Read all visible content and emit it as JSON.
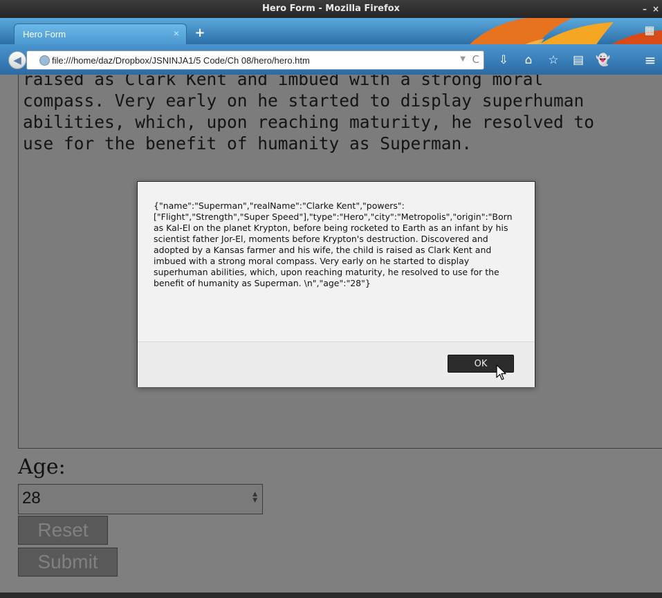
{
  "window": {
    "title": "Hero Form - Mozilla Firefox",
    "controls": [
      "–",
      "×"
    ]
  },
  "tabs": [
    {
      "label": "Hero Form",
      "close": "×"
    }
  ],
  "newtab": "+",
  "nav": {
    "back": "◀",
    "url": "file:///home/daz/Dropbox/JSNINJA1/5 Code/Ch 08/hero/hero.htm",
    "url_dropdown": "▼",
    "reload": "C",
    "icons": [
      "download-icon",
      "home-icon",
      "bookmark-star-icon",
      "reading-list-icon",
      "ghostery-icon"
    ],
    "icon_glyphs": [
      "⇩",
      "⌂",
      "☆",
      "▤",
      "👻"
    ],
    "menu": "≡",
    "tab_groups": "▦"
  },
  "page": {
    "origin_text": "raised as Clark Kent and imbued with a strong moral\ncompass. Very early on he started to display superhuman\nabilities, which, upon reaching maturity, he resolved to\nuse for the benefit of humanity as Superman.",
    "age_label": "Age:",
    "age_value": "28",
    "reset_label": "Reset",
    "submit_label": "Submit"
  },
  "dialog": {
    "message": "{\"name\":\"Superman\",\"realName\":\"Clarke Kent\",\"powers\":[\"Flight\",\"Strength\",\"Super Speed\"],\"type\":\"Hero\",\"city\":\"Metropolis\",\"origin\":\"Born as Kal-El on the planet Krypton, before being rocketed to Earth as an infant by his scientist father Jor-El, moments before Krypton's destruction. Discovered and adopted by a Kansas farmer and his wife, the child is raised as Clark Kent and imbued with a strong moral compass. Very early on he started to display superhuman abilities, which, upon reaching maturity, he resolved to use for the benefit of humanity as Superman. \\n\",\"age\":\"28\"}",
    "ok_label": "OK"
  },
  "colors": {
    "tabstrip": "#4a98d0",
    "page_overlay": "#7f7f7f",
    "dialog_bg": "#f2f2f2",
    "ok_button": "#2c2c2c"
  }
}
